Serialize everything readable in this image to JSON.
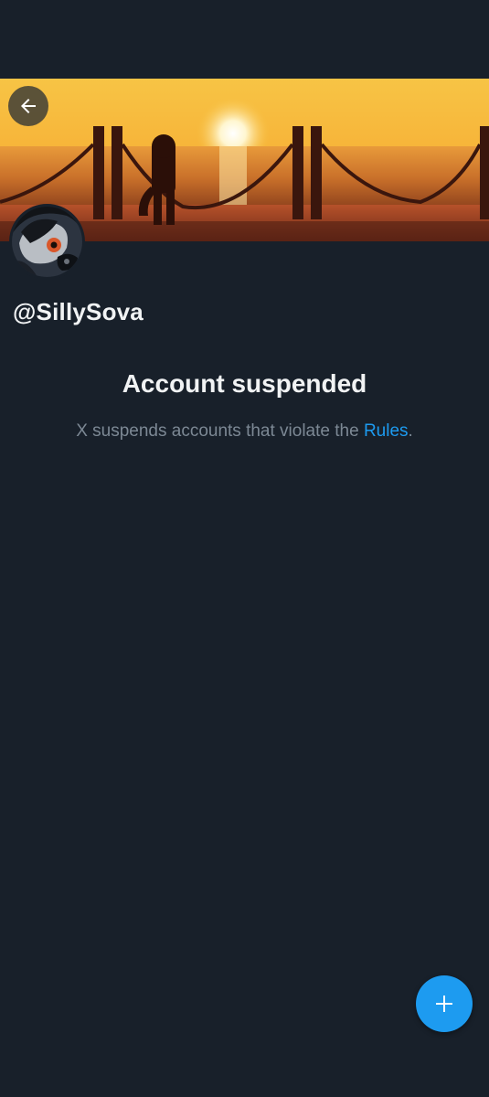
{
  "profile": {
    "handle": "@SillySova",
    "banner_description_icon": "sunset-pier-banner",
    "avatar_icon": "avatar-image"
  },
  "header": {
    "back_icon": "arrow-left-icon"
  },
  "suspension": {
    "title": "Account suspended",
    "message_prefix": "X suspends accounts that violate the ",
    "rules_link": "Rules",
    "message_suffix": "."
  },
  "fab": {
    "icon": "plus-icon"
  },
  "colors": {
    "background": "#18202a",
    "accent": "#1d9bf0",
    "muted_text": "#7c8894",
    "primary_text": "#f1f3f4"
  }
}
